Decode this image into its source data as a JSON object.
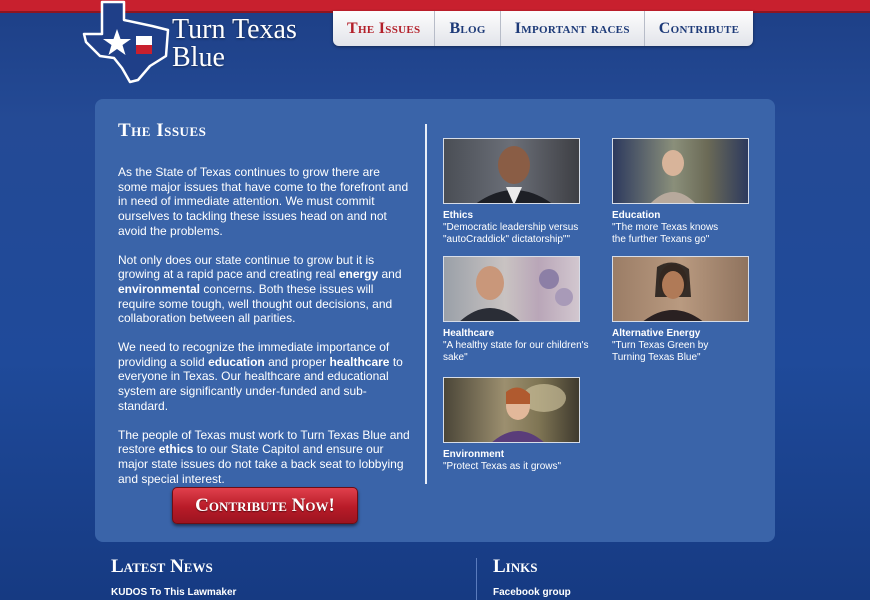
{
  "header": {
    "logo_text_line1": "Turn Texas",
    "logo_text_line2": "Blue"
  },
  "nav": [
    {
      "label": "The Issues",
      "active": true
    },
    {
      "label": "Blog",
      "active": false
    },
    {
      "label": "Important races",
      "active": false
    },
    {
      "label": "Contribute",
      "active": false
    }
  ],
  "issues": {
    "title": "The Issues",
    "p1": "As the State of Texas continues to grow there are some major issues that have come to the forefront and in need of immediate attention. We must commit ourselves to tackling these issues head on and not avoid the problems.",
    "p2_a": "Not only does our state continue to grow but it is growing at a rapid pace and creating real ",
    "p2_b1": "energy",
    "p2_c": " and ",
    "p2_b2": "environmental",
    "p2_d": " concerns. Both these issues will require some tough, well thought out decisions, and collaboration between all parities.",
    "p3_a": "We need to recognize the immediate importance of providing a solid ",
    "p3_b1": "education",
    "p3_c": " and proper ",
    "p3_b2": "healthcare",
    "p3_d": " to everyone in Texas. Our healthcare and educational system are significantly under-funded and sub-standard.",
    "p4_a": "The people of Texas must work to Turn Texas Blue and restore ",
    "p4_b1": "ethics",
    "p4_c": " to our State Capitol and ensure our major state issues do not take a back seat to lobbying and special interest.",
    "contribute_label": "Contribute Now!"
  },
  "videos": [
    {
      "title": "Ethics",
      "caption": "\"Democratic leadership versus \"autoCraddick\" dictatorship\"\""
    },
    {
      "title": "Education",
      "caption": "\"The more Texas knows the further Texans go\""
    },
    {
      "title": "Healthcare",
      "caption": "\"A healthy state for our children's sake\""
    },
    {
      "title": "Alternative Energy",
      "caption": "\"Turn Texas Green by Turning Texas Blue\""
    },
    {
      "title": "Environment",
      "caption": "\"Protect Texas as it grows\""
    }
  ],
  "footer": {
    "news_title": "Latest News",
    "news_item": "KUDOS To This Lawmaker",
    "links_title": "Links",
    "link_item": "Facebook group"
  },
  "colors": {
    "brand_red": "#c8202e",
    "brand_blue": "#1d3a78",
    "panel": "#3a64a9"
  }
}
